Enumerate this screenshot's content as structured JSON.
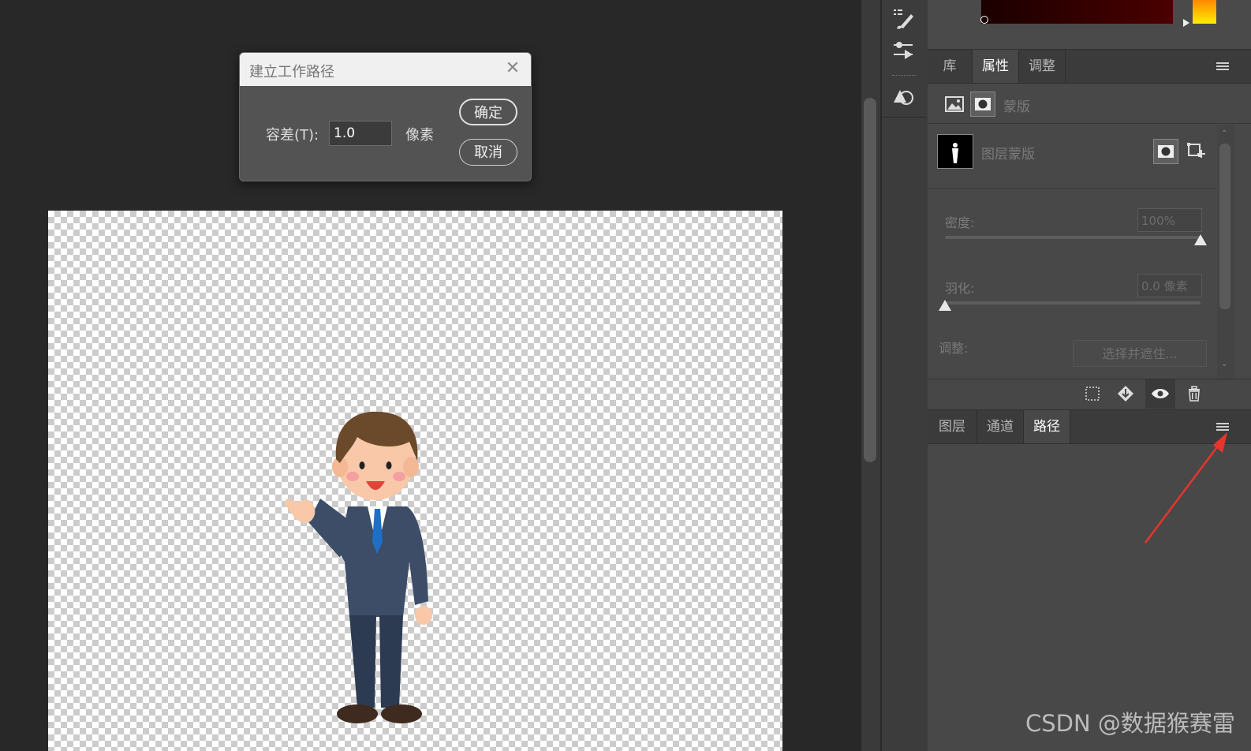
{
  "dialog": {
    "title": "建立工作路径",
    "tolerance_label": "容差(T):",
    "tolerance_value": "1.0",
    "unit": "像素",
    "ok": "确定",
    "cancel": "取消"
  },
  "properties_panel": {
    "tabs": [
      "库",
      "属性",
      "调整"
    ],
    "active_tab": "属性",
    "mask_type_label": "蒙版",
    "layer_mask_label": "图层蒙版",
    "density_label": "密度:",
    "density_value": "100%",
    "density": 1.0,
    "feather_label": "羽化:",
    "feather_value": "0.0 像素",
    "feather": 0.0,
    "refine_label": "调整:",
    "refine_button": "选择并遮住..."
  },
  "layers_panel": {
    "tabs": [
      "图层",
      "通道",
      "路径"
    ],
    "active_tab": "路径"
  },
  "watermark": "CSDN @数据猴赛雷",
  "colors": {
    "workspace": "#282828",
    "panel": "#484848",
    "tabbar": "#3b3b3b",
    "annotation_arrow": "#e8352b"
  },
  "icons": [
    "brush-settings-icon",
    "adjustments-icon",
    "shapes-icon",
    "pixel-mask-icon",
    "vector-mask-icon",
    "selection-from-mask-icon",
    "apply-mask-icon",
    "visibility-eye-icon",
    "trash-icon",
    "panel-menu-icon",
    "close-icon"
  ]
}
